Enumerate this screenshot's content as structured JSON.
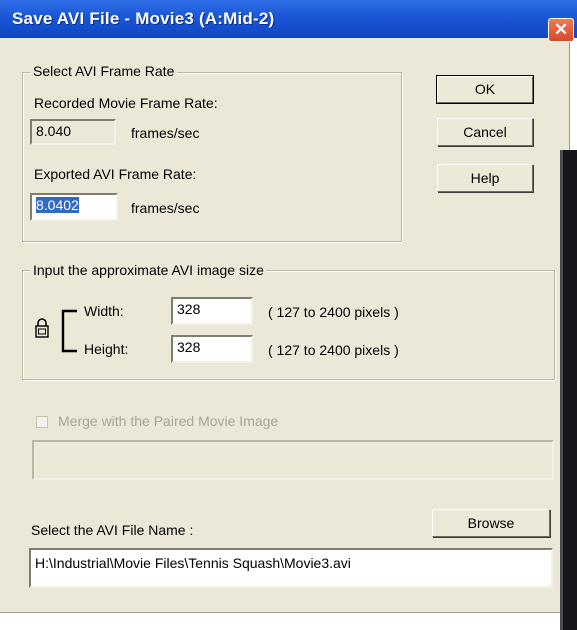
{
  "window": {
    "title": "Save AVI File - Movie3 (A:Mid-2)",
    "close_glyph": "✕"
  },
  "frame_rate": {
    "group_label": "Select AVI Frame Rate",
    "recorded_label": "Recorded Movie Frame Rate:",
    "recorded_value": "8.040",
    "recorded_unit": "frames/sec",
    "exported_label": "Exported AVI Frame Rate:",
    "exported_value": "8.0402",
    "exported_unit": "frames/sec"
  },
  "image_size": {
    "group_label": "Input the approximate AVI image size",
    "width_label": "Width:",
    "width_value": "328",
    "width_range": "( 127 to 2400  pixels )",
    "height_label": "Height:",
    "height_value": "328",
    "height_range": "( 127 to 2400  pixels )",
    "lock_icon": "lock-icon"
  },
  "merge": {
    "checkbox_label": "Merge with the Paired Movie Image",
    "checked": false,
    "enabled": false,
    "path_value": ""
  },
  "file": {
    "label": "Select the AVI File Name :",
    "path_value": "H:\\Industrial\\Movie Files\\Tennis Squash\\Movie3.avi",
    "browse_label": "Browse"
  },
  "buttons": {
    "ok_label": "OK",
    "cancel_label": "Cancel",
    "help_label": "Help"
  },
  "colors": {
    "titlebar": "#1a56d6",
    "dialog_bg": "#ebe8d8",
    "selection": "#316ac5",
    "close_button": "#d9472a"
  }
}
